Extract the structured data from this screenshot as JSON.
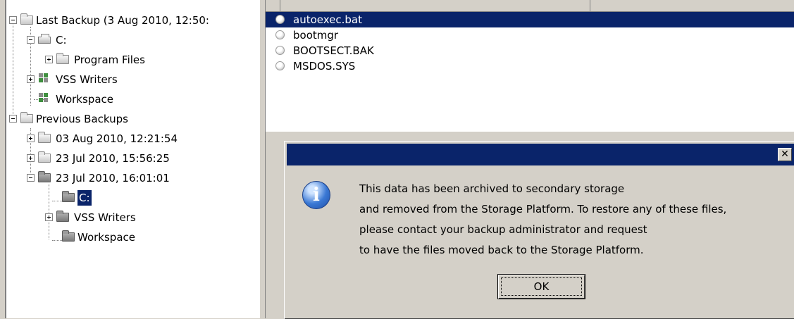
{
  "tree": {
    "last_backup": "Last Backup (3 Aug 2010, 12:50:",
    "drive_c": "C:",
    "program_files": "Program Files",
    "vss_writers_1": "VSS Writers",
    "workspace_1": "Workspace",
    "previous_backups": "Previous Backups",
    "backup_1": "03 Aug 2010, 12:21:54",
    "backup_2": "23 Jul 2010, 15:56:25",
    "backup_3": "23 Jul 2010, 16:01:01",
    "drive_c_2": "C:",
    "vss_writers_2": "VSS Writers",
    "workspace_2": "Workspace"
  },
  "files": [
    {
      "name": "autoexec.bat",
      "selected": true
    },
    {
      "name": "bootmgr"
    },
    {
      "name": "BOOTSECT.BAK"
    },
    {
      "name": "MSDOS.SYS"
    }
  ],
  "dialog": {
    "close_glyph": "✕",
    "lines": [
      "This data has been archived to secondary storage",
      "and removed from the Storage Platform. To restore any of these files,",
      "please contact your backup administrator and request",
      "to have the files moved back to the Storage Platform."
    ],
    "ok_label": "OK",
    "icon": "info-icon"
  },
  "colors": {
    "selection": "#0a246a",
    "face": "#d4d0c8"
  }
}
